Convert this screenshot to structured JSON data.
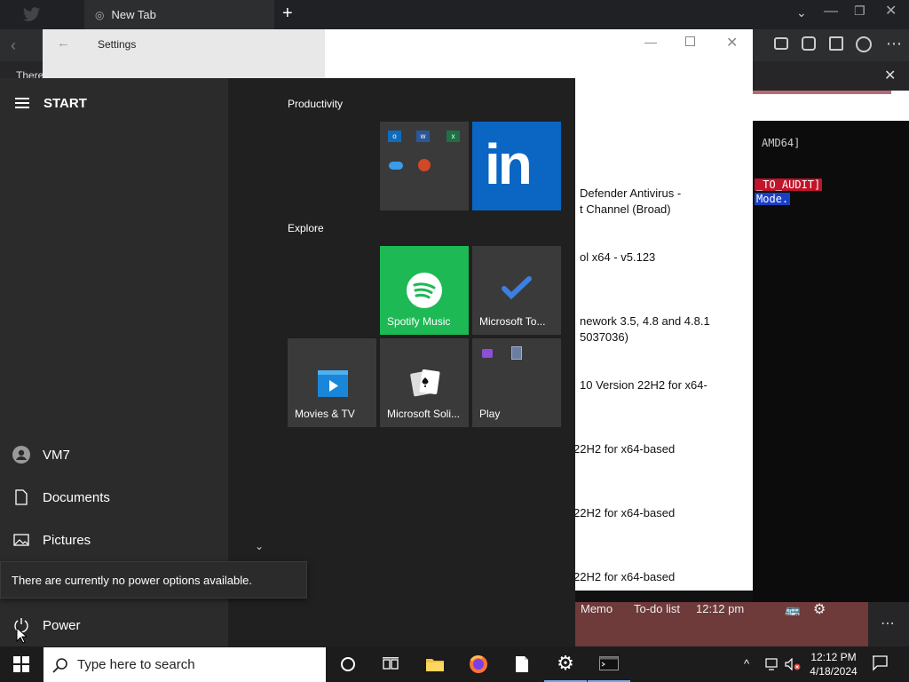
{
  "browser": {
    "tab_title": "New Tab",
    "bar_text": "There"
  },
  "settings": {
    "title": "Settings",
    "updates": [
      "AMD64]",
      "Defender Antivirus -",
      "t Channel (Broad)",
      "ol x64 - v5.123",
      "nework 3.5, 4.8 and 4.8.1",
      "5037036)",
      "10 Version 22H2 for x64-",
      "22H2 for x64-based",
      "22H2 for x64-based",
      "22H2 for x64-based"
    ]
  },
  "terminal": {
    "line1": "AMD64]",
    "line2": "_TO_AUDIT]",
    "line3": "Mode."
  },
  "background_app": {
    "item1": "Memo",
    "item2": "To-do list",
    "item3": "12:12 pm"
  },
  "start": {
    "title": "START",
    "user": "VM7",
    "documents": "Documents",
    "pictures": "Pictures",
    "power": "Power",
    "tooltip": "There are currently no power options available.",
    "groups": {
      "productivity": "Productivity",
      "explore": "Explore"
    },
    "tiles": {
      "spotify": "Spotify Music",
      "todo": "Microsoft To...",
      "movies": "Movies & TV",
      "solitaire": "Microsoft Soli...",
      "play": "Play"
    },
    "colors": {
      "spotify": "#1db954",
      "linkedin": "#0a66c2"
    }
  },
  "taskbar": {
    "search_placeholder": "Type here to search",
    "time": "12:12 PM",
    "date": "4/18/2024"
  }
}
